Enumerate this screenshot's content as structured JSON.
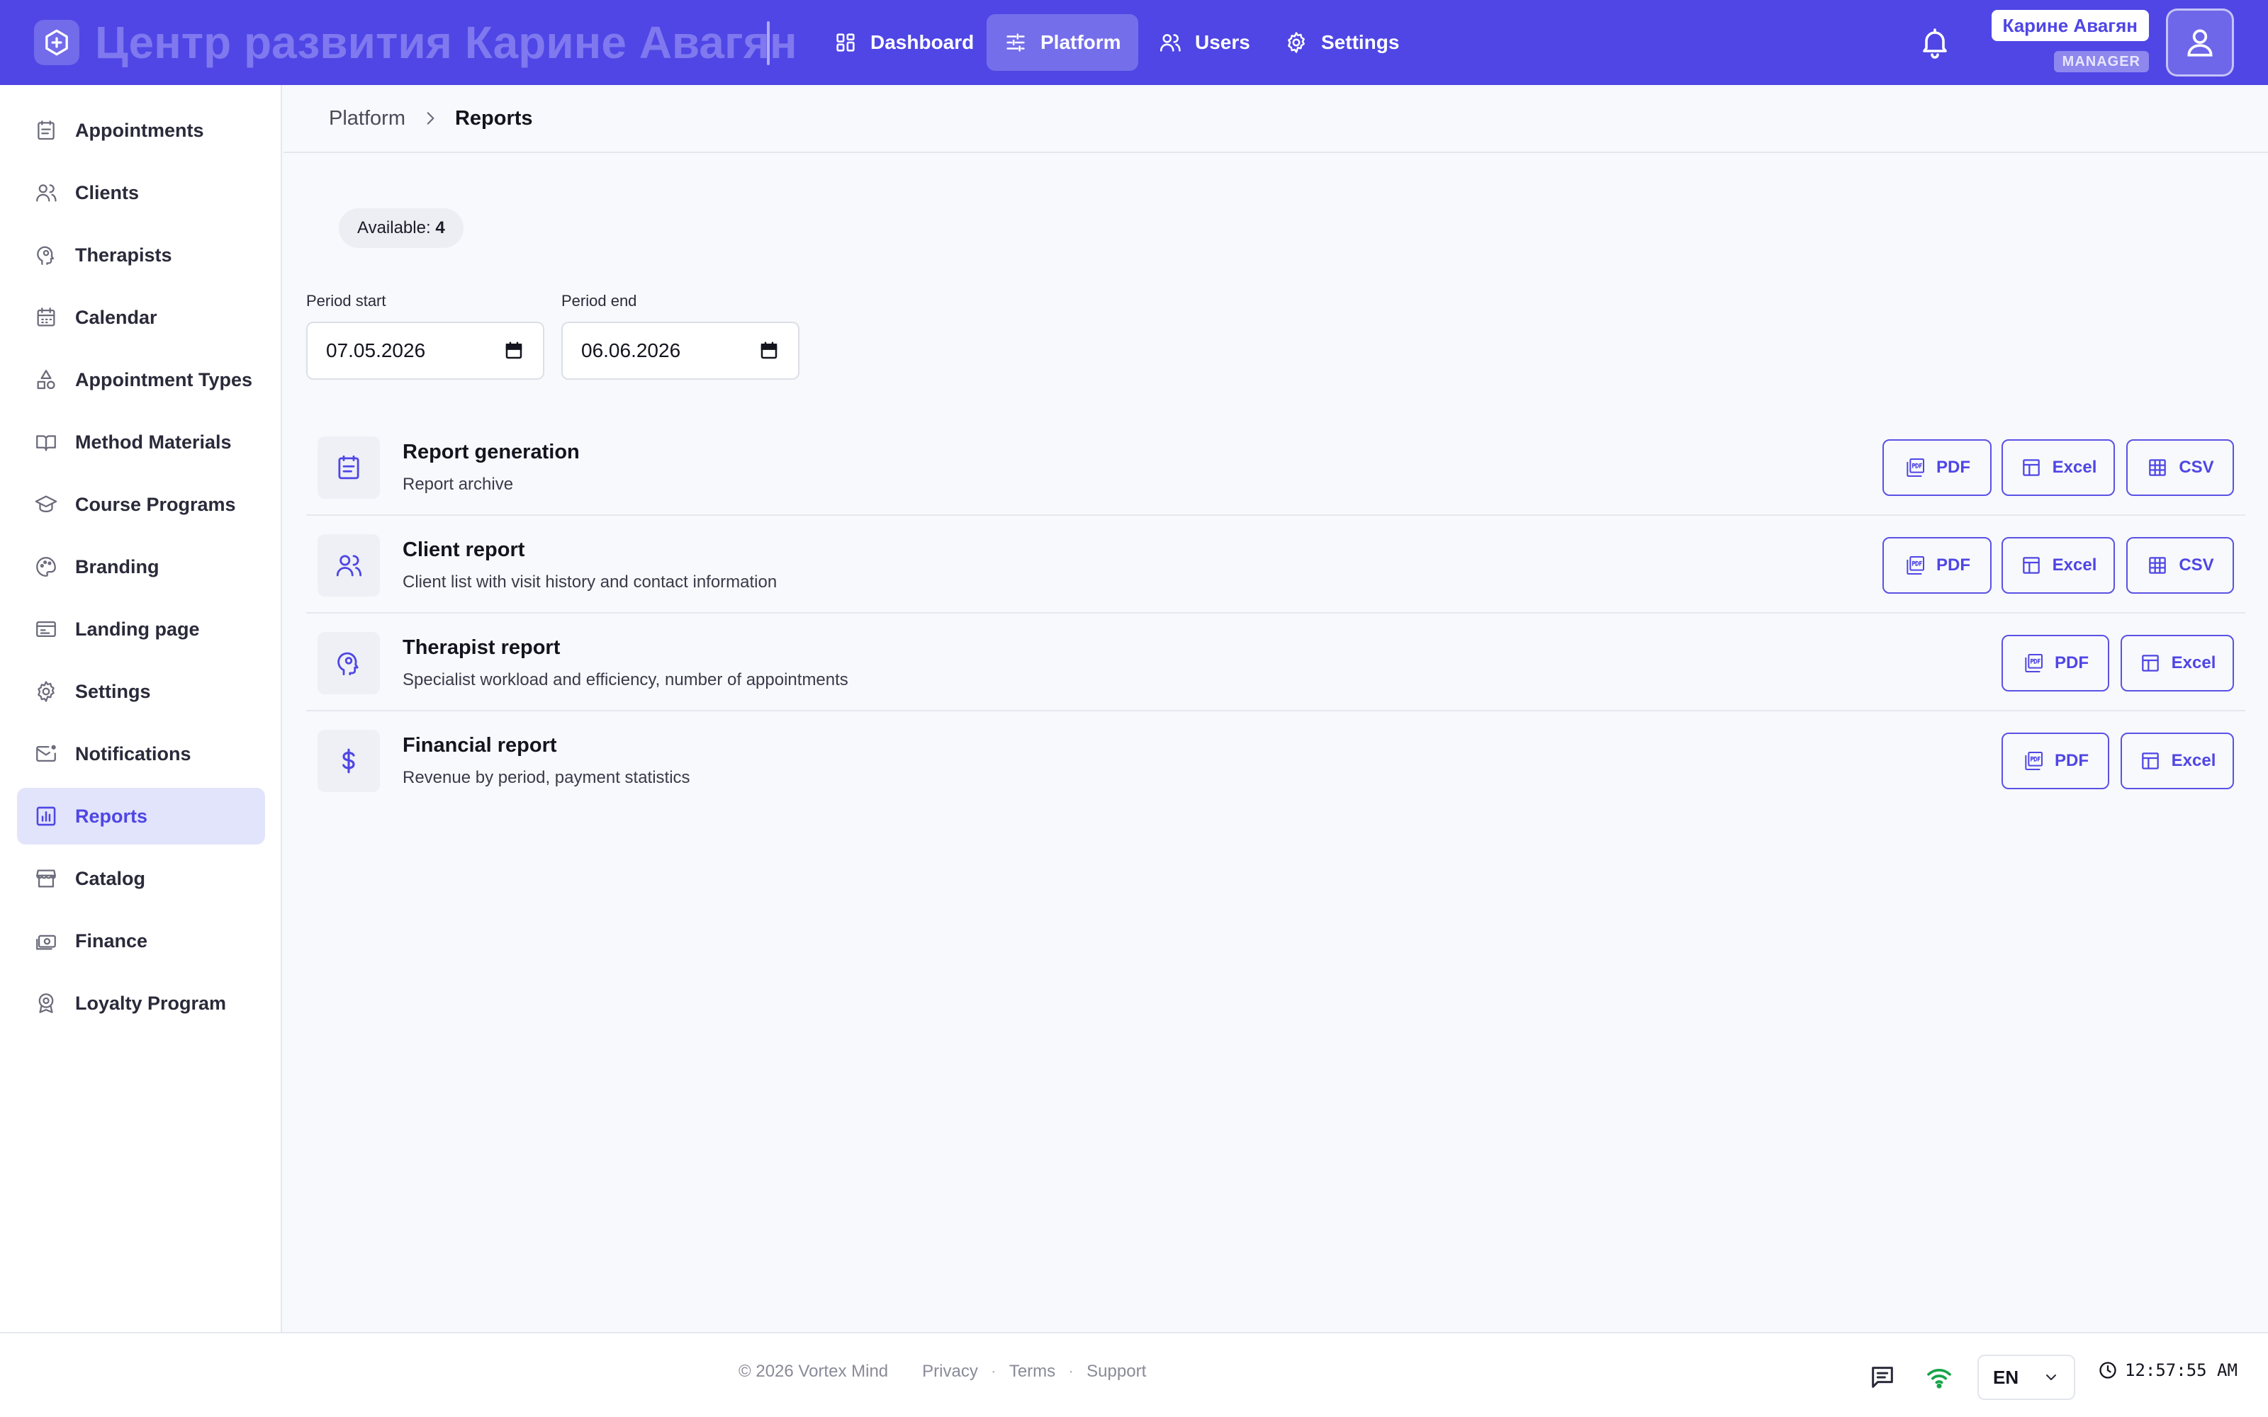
{
  "colors": {
    "accent": "#4f46e5",
    "accent_soft": "#e2e4fb",
    "background": "#f8f9fc",
    "success": "#16a34a"
  },
  "header": {
    "logo_icon": "hexagon-plus-icon",
    "brand": "Центр развития Карине Авагян",
    "nav": [
      {
        "label": "Dashboard",
        "icon": "dashboard-icon"
      },
      {
        "label": "Platform",
        "icon": "sliders-icon",
        "active": true
      },
      {
        "label": "Users",
        "icon": "users-icon"
      },
      {
        "label": "Settings",
        "icon": "gear-icon"
      }
    ],
    "user_name": "Карине Авагян",
    "user_role": "MANAGER"
  },
  "sidebar": {
    "items": [
      {
        "label": "Appointments",
        "icon": "clipboard-icon"
      },
      {
        "label": "Clients",
        "icon": "users-icon"
      },
      {
        "label": "Therapists",
        "icon": "head-gear-icon"
      },
      {
        "label": "Calendar",
        "icon": "calendar-icon"
      },
      {
        "label": "Appointment Types",
        "icon": "shapes-icon"
      },
      {
        "label": "Method Materials",
        "icon": "book-icon"
      },
      {
        "label": "Course Programs",
        "icon": "graduation-cap-icon"
      },
      {
        "label": "Branding",
        "icon": "palette-icon"
      },
      {
        "label": "Landing page",
        "icon": "browser-icon"
      },
      {
        "label": "Settings",
        "icon": "gear-icon"
      },
      {
        "label": "Notifications",
        "icon": "mail-icon"
      },
      {
        "label": "Reports",
        "icon": "bar-chart-icon",
        "active": true
      },
      {
        "label": "Catalog",
        "icon": "store-icon"
      },
      {
        "label": "Finance",
        "icon": "cash-icon"
      },
      {
        "label": "Loyalty Program",
        "icon": "award-icon"
      }
    ]
  },
  "breadcrumb": {
    "parent": "Platform",
    "current": "Reports"
  },
  "available": {
    "label": "Available:",
    "count": "4"
  },
  "period": {
    "start_label": "Period start",
    "start_value": "07.05.2026",
    "end_label": "Period end",
    "end_value": "06.06.2026"
  },
  "reports": [
    {
      "title": "Report generation",
      "description": "Report archive",
      "icon": "clipboard-icon",
      "exports": [
        "PDF",
        "Excel",
        "CSV"
      ]
    },
    {
      "title": "Client report",
      "description": "Client list with visit history and contact information",
      "icon": "users-icon",
      "exports": [
        "PDF",
        "Excel",
        "CSV"
      ]
    },
    {
      "title": "Therapist report",
      "description": "Specialist workload and efficiency, number of appointments",
      "icon": "head-gear-icon",
      "exports": [
        "PDF",
        "Excel"
      ]
    },
    {
      "title": "Financial report",
      "description": "Revenue by period, payment statistics",
      "icon": "dollar-icon",
      "exports": [
        "PDF",
        "Excel"
      ]
    }
  ],
  "footer": {
    "copyright": "© 2026 Vortex Mind",
    "links": [
      "Privacy",
      "Terms",
      "Support"
    ],
    "language": "EN",
    "time": "12:57:55 AM"
  }
}
